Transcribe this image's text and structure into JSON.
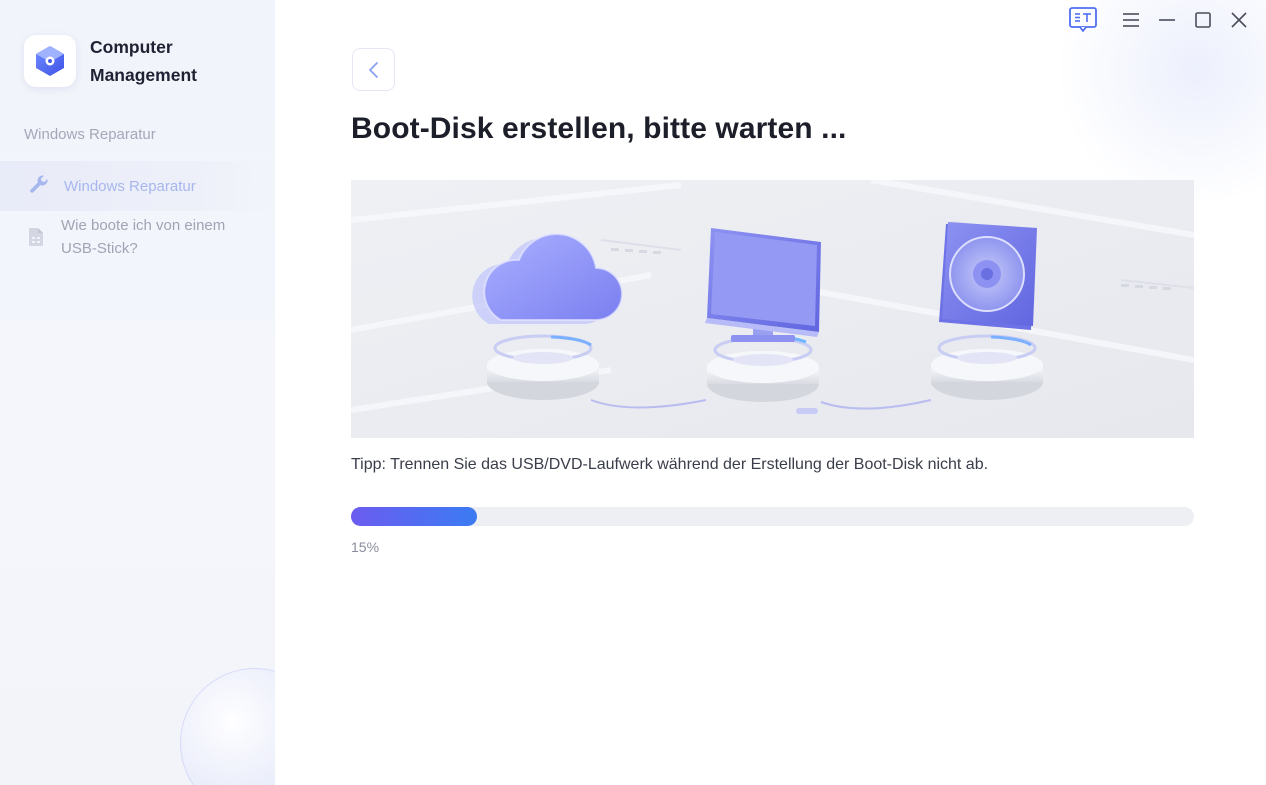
{
  "app": {
    "title": "Computer Management"
  },
  "sidebar": {
    "section_label": "Windows Reparatur",
    "items": [
      {
        "label": "Windows Reparatur",
        "icon": "wrench-icon",
        "active": true
      },
      {
        "label": "Wie boote ich von einem USB-Stick?",
        "icon": "document-icon",
        "active": false
      }
    ]
  },
  "window_controls": [
    "feedback-icon",
    "menu-icon",
    "minimize-icon",
    "maximize-icon",
    "close-icon"
  ],
  "main": {
    "title": "Boot-Disk erstellen, bitte warten ...",
    "tip": "Tipp: Trennen Sie das USB/DVD-Laufwerk während der Erstellung der Boot-Disk nicht ab.",
    "progress": {
      "value": 0.15,
      "label": "15%"
    },
    "illustration_icons": [
      "cloud-icon",
      "monitor-icon",
      "disc-icon"
    ]
  },
  "colors": {
    "accent": "#3b7bf2",
    "accent_start": "#6b5cf0",
    "active_nav_text": "#a7b7ee",
    "title_text": "#1c1e29",
    "illustration_purple": "#8d92f2"
  }
}
